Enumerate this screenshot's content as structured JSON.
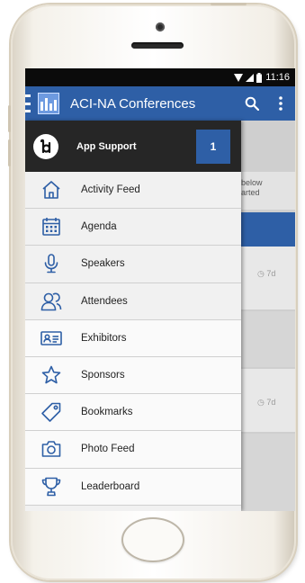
{
  "status_bar": {
    "time": "11:16"
  },
  "app_bar": {
    "title": "ACI-NA Conferences"
  },
  "drawer": {
    "header": {
      "label": "App Support",
      "badge": "1"
    },
    "items": [
      {
        "label": "Activity Feed",
        "icon": "home-icon"
      },
      {
        "label": "Agenda",
        "icon": "calendar-icon"
      },
      {
        "label": "Speakers",
        "icon": "microphone-icon"
      },
      {
        "label": "Attendees",
        "icon": "people-icon"
      },
      {
        "label": "Exhibitors",
        "icon": "id-card-icon"
      },
      {
        "label": "Sponsors",
        "icon": "star-icon"
      },
      {
        "label": "Bookmarks",
        "icon": "tag-icon"
      },
      {
        "label": "Photo Feed",
        "icon": "camera-icon"
      },
      {
        "label": "Leaderboard",
        "icon": "trophy-icon"
      }
    ]
  },
  "background": {
    "text_line_1": "below",
    "text_line_2": "arted",
    "time_1": "7d",
    "time_2": "7d"
  },
  "colors": {
    "accent": "#2e5fa6",
    "drawer_header": "#262626",
    "icon_stroke": "#2e5fa6"
  }
}
